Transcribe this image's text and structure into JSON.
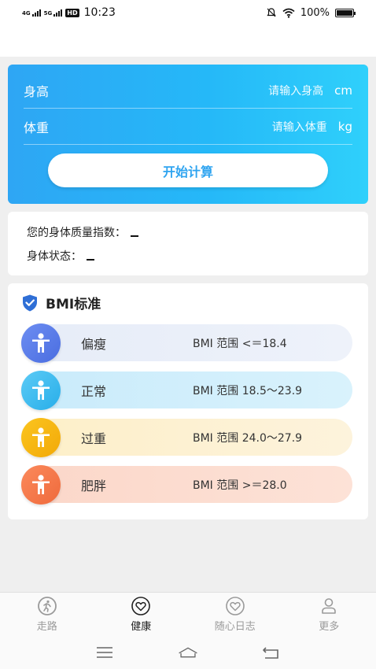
{
  "status_bar": {
    "net1": "4G",
    "net2": "5G",
    "hd": "HD",
    "time": "10:23",
    "battery": "100%",
    "battery_level": 1.0
  },
  "input_card": {
    "height_label": "身高",
    "height_placeholder": "请输入身高",
    "height_unit": "cm",
    "weight_label": "体重",
    "weight_placeholder": "请输入体重",
    "weight_unit": "kg",
    "calc_button": "开始计算"
  },
  "result": {
    "bmi_label": "您的身体质量指数：",
    "status_label": "身体状态："
  },
  "bmi_standard": {
    "title": "BMI标准",
    "rows": [
      {
        "name": "偏瘦",
        "range": "BMI 范围 <＝18.4"
      },
      {
        "name": "正常",
        "range": "BMI 范围 18.5～23.9"
      },
      {
        "name": "过重",
        "range": "BMI 范围 24.0～27.9"
      },
      {
        "name": "肥胖",
        "range": "BMI 范围 >＝28.0"
      }
    ]
  },
  "tabs": [
    {
      "label": "走路",
      "icon": "walk-icon"
    },
    {
      "label": "健康",
      "icon": "heart-icon"
    },
    {
      "label": "随心日志",
      "icon": "heart-icon"
    },
    {
      "label": "更多",
      "icon": "user-icon"
    }
  ],
  "colors": {
    "accent": "#2fa4f0",
    "underweight": "#5a7be8",
    "normal": "#36b6ee",
    "overweight": "#f5b511",
    "obese": "#f47545"
  }
}
